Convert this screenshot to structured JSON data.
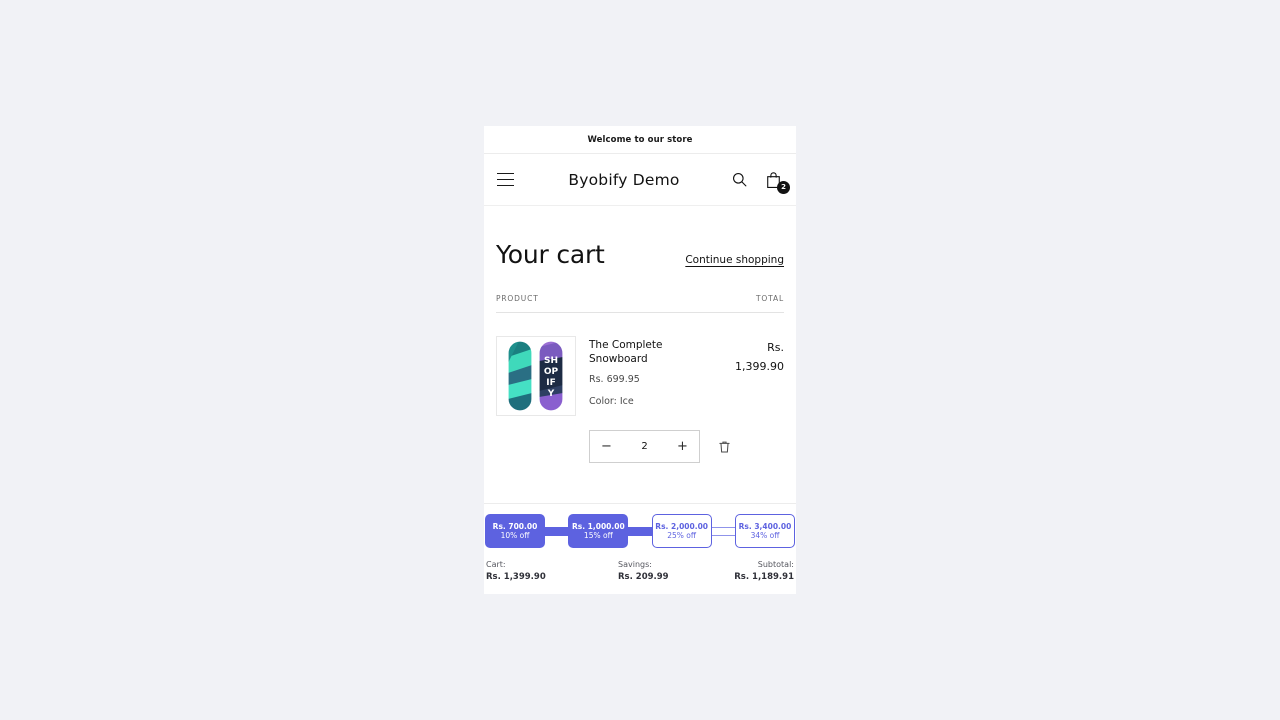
{
  "announcement": {
    "text": "Welcome to our store"
  },
  "header": {
    "brand": "Byobify Demo",
    "menu_icon": "hamburger-menu-icon",
    "search_icon": "search-icon",
    "cart_icon": "shopping-bag-icon",
    "cart_count": "2"
  },
  "cart": {
    "title": "Your cart",
    "continue_link": "Continue shopping",
    "col_product": "PRODUCT",
    "col_total": "TOTAL",
    "item": {
      "name": "The Complete Snowboard",
      "unit_price": "Rs. 699.95",
      "variant": "Color: Ice",
      "total_currency": "Rs.",
      "total_amount": "1,399.90",
      "quantity": "2",
      "decrease_label": "−",
      "increase_label": "+",
      "remove_icon": "trash-icon",
      "thumb_icon": "snowboard-pair-image"
    }
  },
  "tiers": {
    "accent_color": "#5d62e0",
    "accent_light": "#8f93ea",
    "nodes": [
      {
        "amount": "Rs. 700.00",
        "discount": "10% off",
        "reached": true
      },
      {
        "amount": "Rs. 1,000.00",
        "discount": "15% off",
        "reached": true
      },
      {
        "amount": "Rs. 2,000.00",
        "discount": "25% off",
        "reached": false
      },
      {
        "amount": "Rs. 3,400.00",
        "discount": "34% off",
        "reached": false
      }
    ],
    "connectors": [
      "filled",
      "filled",
      "empty"
    ]
  },
  "totals": [
    {
      "label": "Cart:",
      "value": "Rs. 1,399.90"
    },
    {
      "label": "Savings:",
      "value": "Rs. 209.99"
    },
    {
      "label": "Subtotal:",
      "value": "Rs. 1,189.91"
    }
  ]
}
